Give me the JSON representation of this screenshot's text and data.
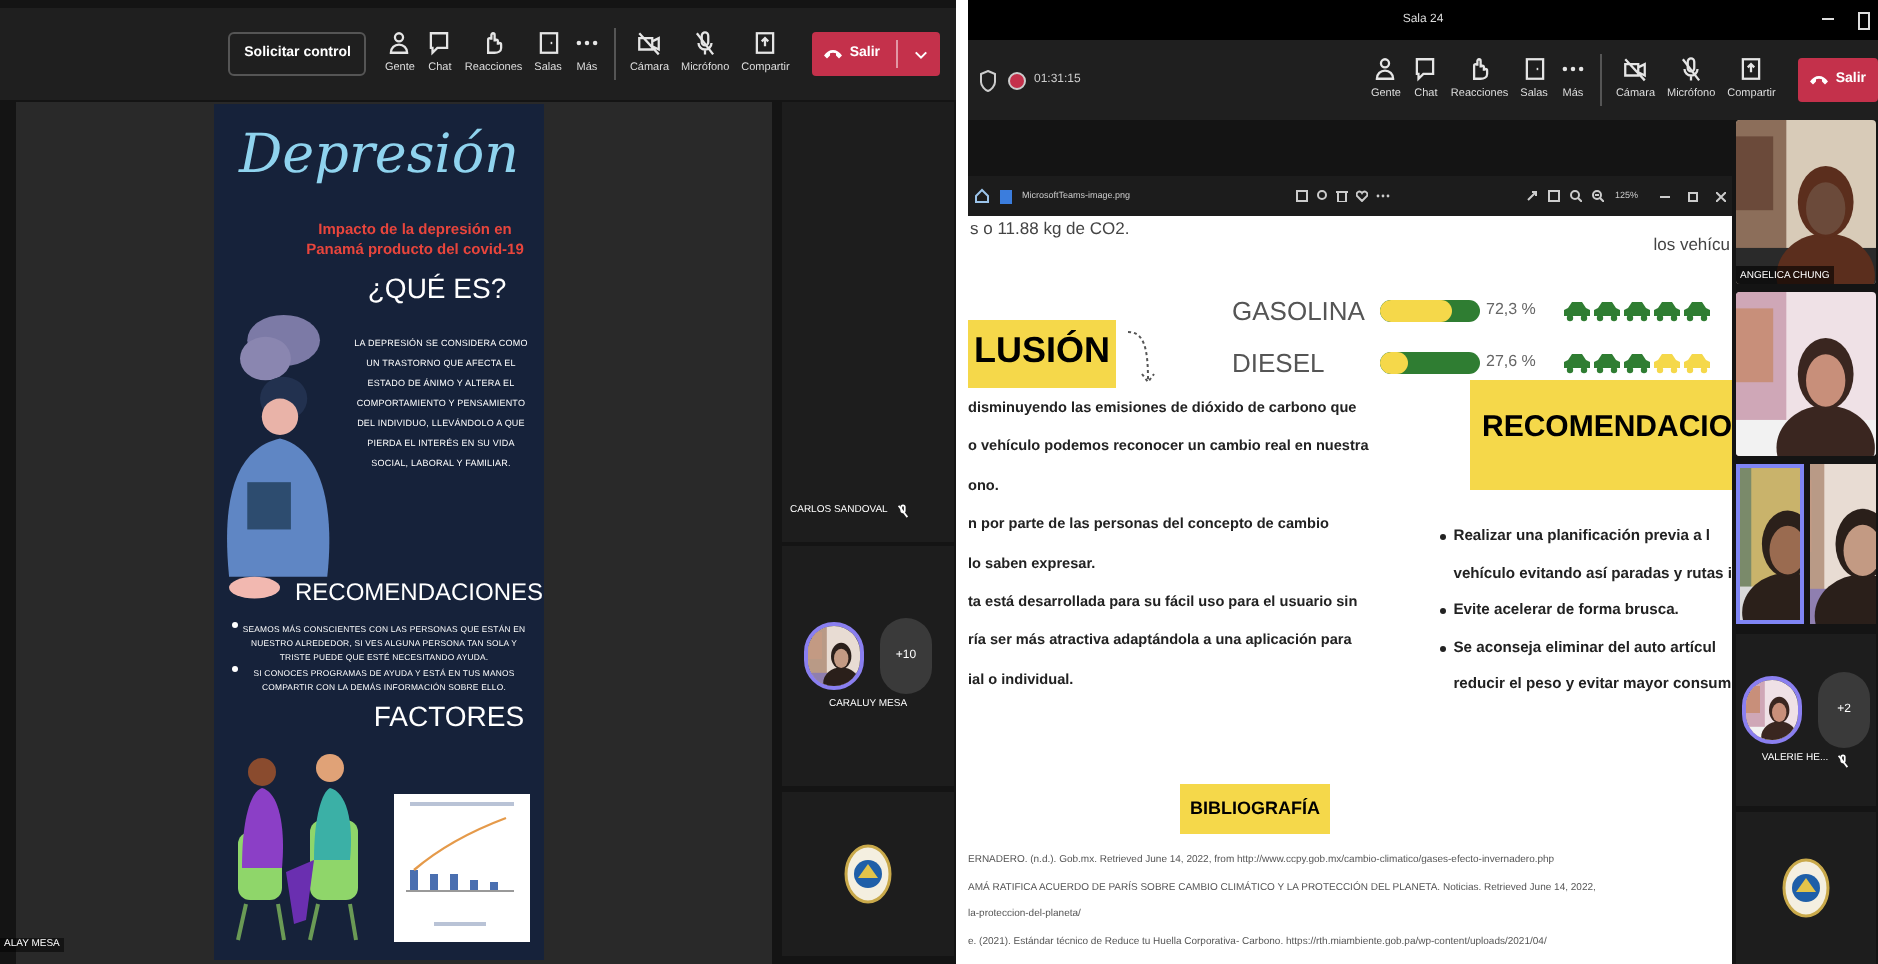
{
  "left_window": {
    "toolbar": {
      "request_control": "Solicitar control",
      "buttons": [
        {
          "kind": "people",
          "label": "Gente"
        },
        {
          "kind": "chat",
          "label": "Chat"
        },
        {
          "kind": "reactions",
          "label": "Reacciones"
        },
        {
          "kind": "rooms",
          "label": "Salas"
        },
        {
          "kind": "more",
          "label": "Más"
        },
        {
          "kind": "camera",
          "label": "Cámara"
        },
        {
          "kind": "mic",
          "label": "Micrófono"
        },
        {
          "kind": "share",
          "label": "Compartir"
        }
      ],
      "leave": {
        "label": "Salir",
        "has_menu": true
      }
    },
    "poster": {
      "title": "Depresión",
      "subtitle": "Impacto de la depresión en Panamá producto del covid-19",
      "heading_1": "¿QUÉ ES?",
      "paragraph": "LA DEPRESIÓN SE CONSIDERA COMO UN TRASTORNO QUE AFECTA EL ESTADO DE ÁNIMO Y ALTERA EL COMPORTAMIENTO Y PENSAMIENTO DEL INDIVIDUO, LLEVÁNDOLO A QUE PIERDA EL INTERÉS EN SU VIDA SOCIAL, LABORAL Y FAMILIAR.",
      "heading_2": "RECOMENDACIONES",
      "bullets": [
        "SEAMOS MÁS CONSCIENTES CON LAS PERSONAS QUE ESTÁN EN NUESTRO ALREDEDOR, SI VES ALGUNA PERSONA TAN SOLA Y TRISTE PUEDE QUE ESTÉ NECESITANDO AYUDA.",
        "SI CONOCES PROGRAMAS DE AYUDA Y ESTÁ EN TUS MANOS COMPARTIR CON LA DEMÁS INFORMACIÓN SOBRE ELLO."
      ],
      "heading_3": "FACTORES"
    },
    "stage_label": "ALAY MESA",
    "participants": [
      {
        "kind": "video",
        "name": "CARLOS SANDOVAL",
        "muted": true
      },
      {
        "kind": "avatars",
        "name": "CARALUY MESA",
        "overflow": "+10",
        "muted": false
      },
      {
        "kind": "logo"
      }
    ]
  },
  "right_window": {
    "title": "Sala 24",
    "recording": true,
    "timer": "01:31:15",
    "toolbar": {
      "buttons": [
        {
          "kind": "people",
          "label": "Gente"
        },
        {
          "kind": "chat",
          "label": "Chat"
        },
        {
          "kind": "reactions",
          "label": "Reacciones"
        },
        {
          "kind": "rooms",
          "label": "Salas"
        },
        {
          "kind": "more",
          "label": "Más"
        },
        {
          "kind": "camera",
          "label": "Cámara"
        },
        {
          "kind": "mic",
          "label": "Micrófono"
        },
        {
          "kind": "share",
          "label": "Compartir"
        }
      ],
      "leave": {
        "label": "Salir",
        "has_menu": false
      }
    },
    "viewer": {
      "file_name": "MicrosoftTeams-image.png",
      "zoom": "125%"
    },
    "slide": {
      "top_left": "s o 11.88 kg de CO2.",
      "top_right": "los vehícu",
      "fuels": [
        {
          "label": "GASOLINA",
          "level": 0.723,
          "reading": "72,3 %",
          "cars": [
            {
              "filled": true
            },
            {
              "filled": true
            },
            {
              "filled": true
            },
            {
              "filled": true
            },
            {
              "filled": true
            }
          ]
        },
        {
          "label": "DIESEL",
          "level": 0.276,
          "reading": "27,6 %",
          "cars": [
            {
              "filled": true
            },
            {
              "filled": true
            },
            {
              "filled": true
            },
            {
              "filled": false
            },
            {
              "filled": false
            }
          ]
        }
      ],
      "conclusion_heading": "LUSIÓN",
      "conclusion_lines": [
        "disminuyendo las emisiones de dióxido de carbono que",
        "o vehículo podemos reconocer un cambio real en nuestra",
        "ono.",
        "n  por parte de las personas del concepto de cambio",
        "lo saben expresar.",
        "ta está desarrollada para su fácil uso para el usuario sin",
        "ría ser más atractiva adaptándola  a una  aplicación para",
        "ial o individual."
      ],
      "recommendation_heading": "RECOMENDACIO",
      "recommendations": [
        [
          "Realizar una planificación previa a l",
          "vehículo evitando así paradas y rutas i"
        ],
        [
          "Evite acelerar de forma brusca."
        ],
        [
          "Se aconseja eliminar del auto artícul",
          "reducir el peso y evitar mayor consum"
        ]
      ],
      "bibliography_heading": "BIBLIOGRAFÍA",
      "references": [
        "ERNADERO. (n.d.). Gob.mx. Retrieved June 14, 2022, from http://www.ccpy.gob.mx/cambio-climatico/gases-efecto-invernadero.php",
        "AMÁ RATIFICA ACUERDO DE PARÍS SOBRE CAMBIO CLIMÁTICO Y LA PROTECCIÓN DEL PLANETA. Noticias. Retrieved June 14, 2022,",
        "la-proteccion-del-planeta/",
        "e. (2021). Estándar técnico de Reduce tu Huella Corporativa- Carbono. https://rth.miambiente.gob.pa/wp-content/uploads/2021/04/"
      ]
    },
    "participants": [
      {
        "kind": "video",
        "name": "ANGELICA CHUNG",
        "muted": false
      },
      {
        "kind": "video"
      },
      {
        "kind": "video_pair"
      },
      {
        "kind": "avatars",
        "name": "VALERIE HE...",
        "overflow": "+2",
        "muted": true
      },
      {
        "kind": "logo"
      }
    ]
  }
}
